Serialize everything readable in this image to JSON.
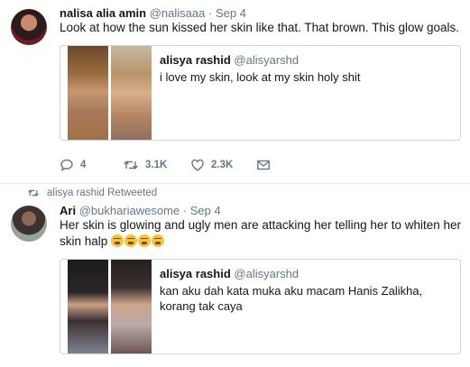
{
  "tweet1": {
    "name": "nalisa alia amin",
    "handle": "@nalisaaa",
    "dot": "·",
    "date": "Sep 4",
    "text": "Look at how the sun kissed her skin like that. That brown. This glow goals.",
    "quote": {
      "name": "alisya rashid",
      "handle": "@alisyarshd",
      "text": "i love my skin, look at my skin holy shit"
    },
    "actions": {
      "reply_count": "4",
      "retweet_count": "3.1K",
      "like_count": "2.3K"
    }
  },
  "retweet_notice": "alisya rashid Retweeted",
  "tweet2": {
    "name": "Ari",
    "handle": "@bukhariawesome",
    "dot": "·",
    "date": "Sep 4",
    "text": "Her skin is glowing and ugly men are attacking her telling her to whiten her skin halp",
    "emoji": [
      "weary-face-icon",
      "weary-face-icon",
      "weary-face-icon",
      "weary-face-icon"
    ],
    "quote": {
      "name": "alisya rashid",
      "handle": "@alisyarshd",
      "text": "kan aku dah kata muka aku macam Hanis Zalikha, korang tak caya"
    }
  },
  "colors": {
    "secondary_text": "#657786",
    "border": "#ccd6dd",
    "divider": "#e6ecf0"
  }
}
